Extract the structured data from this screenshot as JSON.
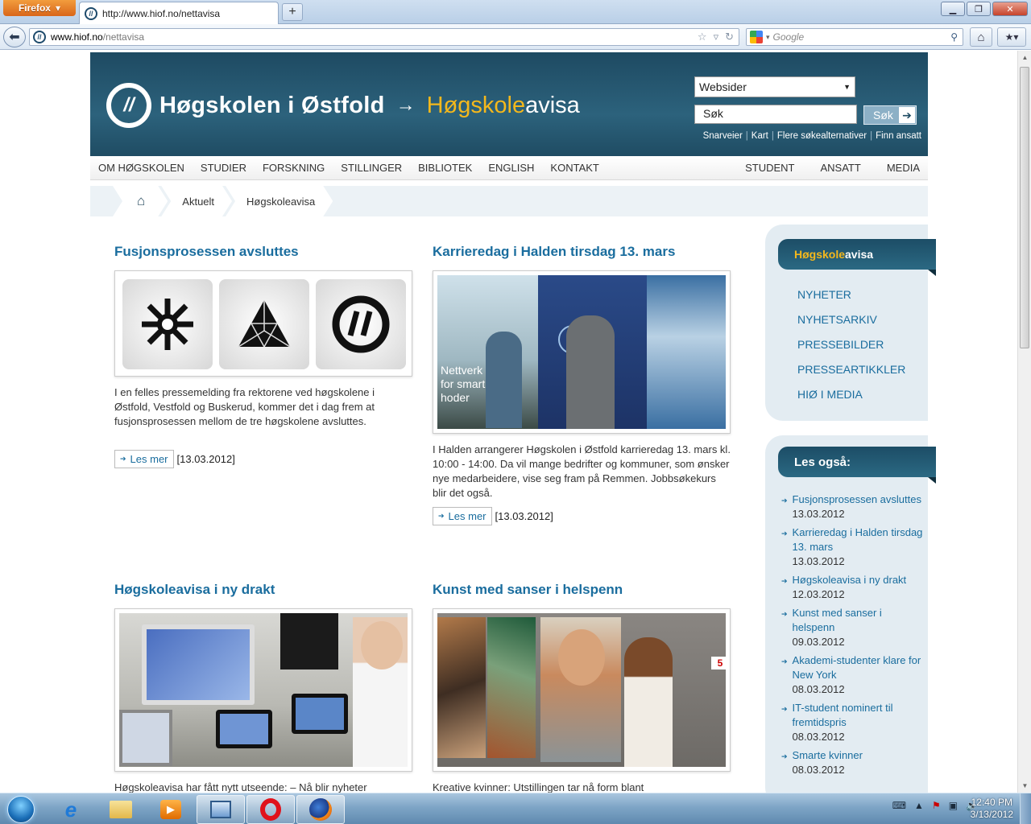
{
  "browser": {
    "firefox_button": "Firefox",
    "tab_title": "http://www.hiof.no/nettavisa",
    "url_domain": "www.hiof.no",
    "url_path": "/nettavisa",
    "search_placeholder": "Google"
  },
  "header": {
    "logo_name": "Høgskolen i Østfold",
    "logo_arrow": "→",
    "logo_part1": "Høgskole",
    "logo_part2": "avisa",
    "select_value": "Websider",
    "search_value": "Søk",
    "search_button": "Søk",
    "quick_links": [
      "Snarveier",
      "Kart",
      "Flere søkealternativer",
      "Finn ansatt"
    ]
  },
  "menu": {
    "left": [
      "OM HØGSKOLEN",
      "STUDIER",
      "FORSKNING",
      "STILLINGER",
      "BIBLIOTEK",
      "ENGLISH",
      "KONTAKT"
    ],
    "right": [
      "STUDENT",
      "ANSATT",
      "MEDIA"
    ]
  },
  "breadcrumb": [
    "Aktuelt",
    "Høgskoleavisa"
  ],
  "articles": [
    {
      "title": "Fusjonsprosessen avsluttes",
      "text": "I en felles pressemelding fra rektorene ved høgskolene i Østfold, Vestfold og Buskerud, kommer det i dag frem at fusjonsprosessen mellom de tre høgskolene avsluttes.",
      "more": "Les mer",
      "date": "[13.03.2012]"
    },
    {
      "title": "Karrieredag i Halden tirsdag 13. mars",
      "text": "I Halden arrangerer Høgskolen i Østfold karrieredag 13. mars kl. 10:00 - 14:00. Da vil mange bedrifter og kommuner, som ønsker nye medarbeidere, vise seg fram på Remmen. Jobbsøkekurs blir det også.",
      "more": "Les mer",
      "date": "[13.03.2012]",
      "image_text": "Nettverk for smart hoder"
    },
    {
      "title": "Høgskoleavisa i ny drakt",
      "text": "Høgskoleavisa har fått nytt utseende: – Nå blir nyheter"
    },
    {
      "title": "Kunst med sanser i helspenn",
      "text": "Kreative kvinner: Utstillingen tar nå form blant",
      "image_badge": "5"
    }
  ],
  "sidebar": {
    "box1_title_part1": "Høgskole",
    "box1_title_part2": "avisa",
    "nav": [
      "NYHETER",
      "NYHETSARKIV",
      "PRESSEBILDER",
      "PRESSEARTIKKLER",
      "HIØ I MEDIA"
    ],
    "box2_title": "Les også:",
    "also": [
      {
        "title": "Fusjonsprosessen avsluttes",
        "date": "13.03.2012"
      },
      {
        "title": "Karrieredag i Halden tirsdag 13. mars",
        "date": "13.03.2012"
      },
      {
        "title": "Høgskoleavisa i ny drakt",
        "date": "12.03.2012"
      },
      {
        "title": "Kunst med sanser i helspenn",
        "date": "09.03.2012"
      },
      {
        "title": "Akademi-studenter klare for New York",
        "date": "08.03.2012"
      },
      {
        "title": "IT-student nominert til fremtidspris",
        "date": "08.03.2012"
      },
      {
        "title": "Smarte kvinner",
        "date": "08.03.2012"
      }
    ]
  },
  "taskbar": {
    "time": "12:40 PM",
    "date": "3/13/2012"
  },
  "colors": {
    "header_blue": "#1e4a62",
    "link_blue": "#1a6d9e",
    "accent_yellow": "#f4b81c"
  }
}
